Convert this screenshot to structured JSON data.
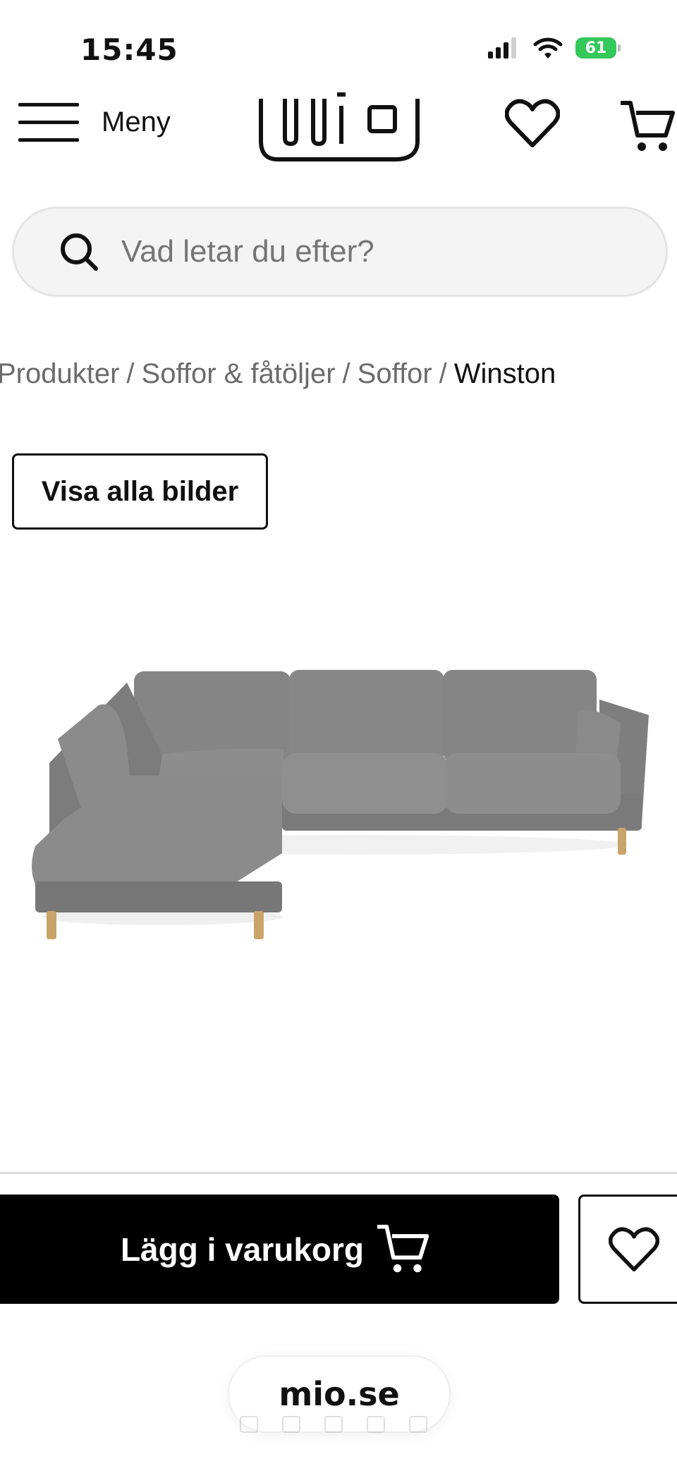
{
  "status_bar": {
    "time": "15:45",
    "battery": "61"
  },
  "header": {
    "menu_label": "Meny",
    "logo_alt": "mio"
  },
  "search": {
    "placeholder": "Vad letar du efter?"
  },
  "breadcrumb": [
    {
      "label": "Produkter"
    },
    {
      "label": "Soffor & fåtöljer"
    },
    {
      "label": "Soffor"
    },
    {
      "label": "Winston"
    }
  ],
  "breadcrumb_separator": "/",
  "gallery": {
    "show_all_label": "Visa alla bilder"
  },
  "purchase": {
    "add_to_cart_label": "Lägg i varukorg"
  },
  "browser": {
    "url": "mio.se"
  },
  "colors": {
    "accent": "#000000",
    "battery": "#34c759",
    "sofa": "#7b7b7b",
    "legs": "#c9a46a"
  }
}
